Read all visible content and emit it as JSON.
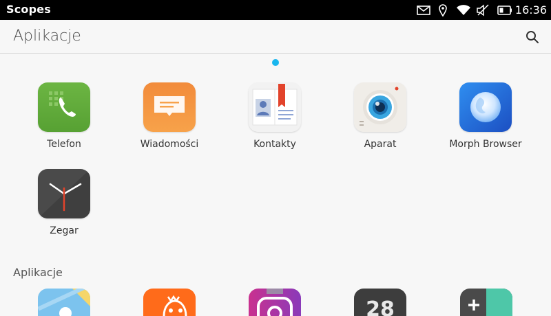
{
  "status_bar": {
    "title": "Scopes",
    "time": "16:36",
    "icons": [
      "mail-icon",
      "location-icon",
      "wifi-icon",
      "volume-muted-icon",
      "battery-icon"
    ]
  },
  "header": {
    "title": "Aplikacje",
    "search_icon": "search-icon"
  },
  "pager": {
    "active_color": "#19b6ee"
  },
  "favorites": [
    {
      "label": "Telefon",
      "icon": "phone-icon"
    },
    {
      "label": "Wiadomości",
      "icon": "messages-icon"
    },
    {
      "label": "Kontakty",
      "icon": "contacts-icon"
    },
    {
      "label": "Aparat",
      "icon": "camera-icon"
    },
    {
      "label": "Morph Browser",
      "icon": "browser-icon"
    },
    {
      "label": "Zegar",
      "icon": "clock-icon"
    }
  ],
  "apps_section": {
    "title": "Aplikacje",
    "partial_icons": [
      "weather-icon",
      "lion-icon",
      "instagram-icon",
      "calendar-icon",
      "calculator-icon"
    ]
  }
}
